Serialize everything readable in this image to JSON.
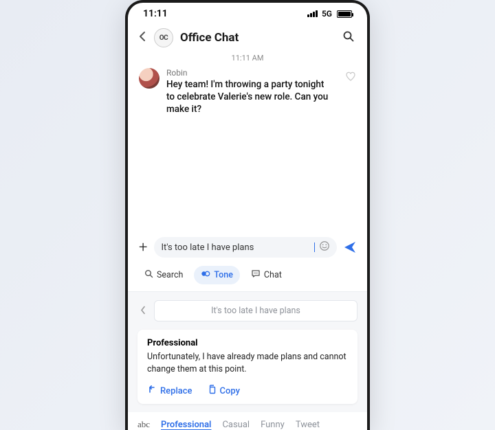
{
  "status": {
    "time": "11:11",
    "network": "5G"
  },
  "header": {
    "oc": "OC",
    "title": "Office Chat"
  },
  "timestamp": "11:11 AM",
  "message": {
    "sender": "Robin",
    "text": "Hey team! I'm throwing a party tonight to celebrate Valerie's new role. Can you make it?"
  },
  "compose": {
    "value": "It's too late I have plans"
  },
  "kb_options": {
    "search": "Search",
    "tone": "Tone",
    "chat": "Chat"
  },
  "preview": "It's too late I have plans",
  "suggestion": {
    "title": "Professional",
    "text": "Unfortunately, I have already made plans and cannot change them at this point.",
    "replace": "Replace",
    "copy": "Copy"
  },
  "tone_bar": {
    "abc": "abc",
    "options": [
      "Professional",
      "Casual",
      "Funny",
      "Tweet"
    ],
    "active_index": 0
  }
}
